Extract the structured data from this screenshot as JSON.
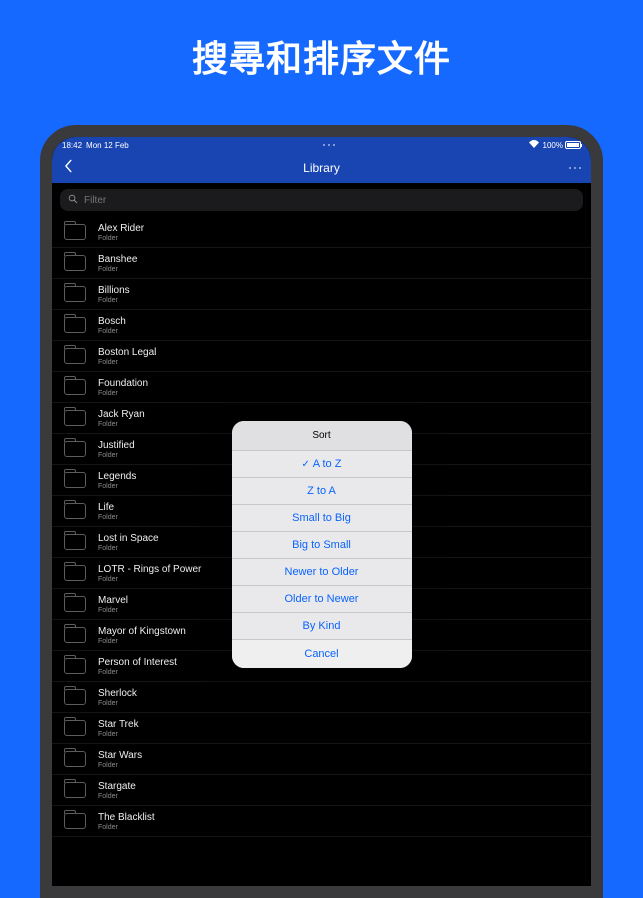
{
  "headline": "搜尋和排序文件",
  "status": {
    "time": "18:42",
    "date": "Mon 12 Feb",
    "battery": "100%"
  },
  "nav": {
    "title": "Library"
  },
  "search": {
    "placeholder": "Filter"
  },
  "folder_sub": "Folder",
  "items": [
    {
      "title": "Alex Rider"
    },
    {
      "title": "Banshee"
    },
    {
      "title": "Billions"
    },
    {
      "title": "Bosch"
    },
    {
      "title": "Boston Legal"
    },
    {
      "title": "Foundation"
    },
    {
      "title": "Jack Ryan"
    },
    {
      "title": "Justified"
    },
    {
      "title": "Legends"
    },
    {
      "title": "Life"
    },
    {
      "title": "Lost in Space"
    },
    {
      "title": "LOTR - Rings of Power"
    },
    {
      "title": "Marvel"
    },
    {
      "title": "Mayor of Kingstown"
    },
    {
      "title": "Person of Interest"
    },
    {
      "title": "Sherlock"
    },
    {
      "title": "Star Trek"
    },
    {
      "title": "Star Wars"
    },
    {
      "title": "Stargate"
    },
    {
      "title": "The Blacklist"
    }
  ],
  "sheet": {
    "title": "Sort",
    "options": [
      {
        "label": "A to Z",
        "selected": true
      },
      {
        "label": "Z to A",
        "selected": false
      },
      {
        "label": "Small to Big",
        "selected": false
      },
      {
        "label": "Big to Small",
        "selected": false
      },
      {
        "label": "Newer to Older",
        "selected": false
      },
      {
        "label": "Older to Newer",
        "selected": false
      },
      {
        "label": "By Kind",
        "selected": false
      }
    ],
    "cancel": "Cancel"
  }
}
